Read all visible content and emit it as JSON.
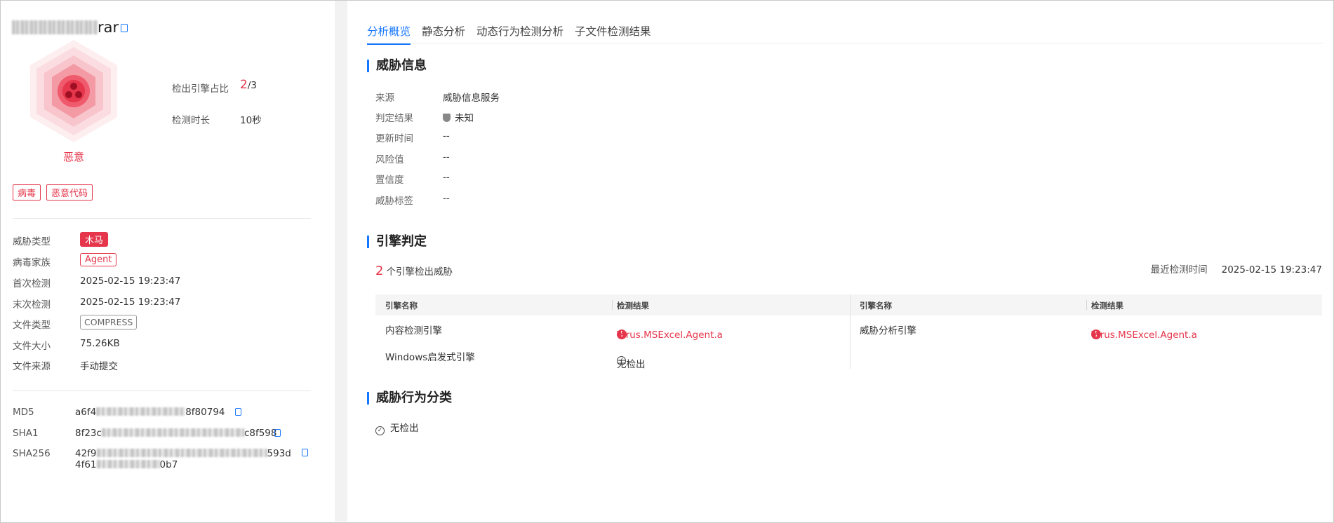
{
  "file": {
    "name_visible": "rar",
    "blurred": true
  },
  "verdict": {
    "label": "恶意"
  },
  "tags": [
    "病毒",
    "恶意代码"
  ],
  "stats": {
    "engine_ratio_label": "检出引擎占比",
    "engine_ratio_hit": "2",
    "engine_ratio_total": "/3",
    "duration_label": "检测时长",
    "duration_value": "10秒"
  },
  "info": {
    "threat_type_label": "威胁类型",
    "threat_type": "木马",
    "family_label": "病毒家族",
    "family": "Agent",
    "first_label": "首次检测",
    "first": "2025-02-15 19:23:47",
    "last_label": "末次检测",
    "last": "2025-02-15 19:23:47",
    "type_label": "文件类型",
    "type": "COMPRESS",
    "size_label": "文件大小",
    "size": "75.26KB",
    "source_label": "文件来源",
    "source": "手动提交"
  },
  "hashes": {
    "md5_label": "MD5",
    "md5_prefix": "a6f4",
    "md5_suffix": "8f80794",
    "sha1_label": "SHA1",
    "sha1_prefix": "8f23c",
    "sha1_suffix": "c8f598",
    "sha256_label": "SHA256",
    "sha256_l1_prefix": "42f9",
    "sha256_l1_suffix": "593d",
    "sha256_l2_prefix": "4f61",
    "sha256_l2_suffix": "0b7"
  },
  "tabs": [
    "分析概览",
    "静态分析",
    "动态行为检测分析",
    "子文件检测结果"
  ],
  "threat_info": {
    "title": "威胁信息",
    "rows": [
      {
        "label": "来源",
        "value": "威胁信息服务"
      },
      {
        "label": "判定结果",
        "value": "未知"
      },
      {
        "label": "更新时间",
        "value": "--"
      },
      {
        "label": "风险值",
        "value": "--"
      },
      {
        "label": "置信度",
        "value": "--"
      },
      {
        "label": "威胁标签",
        "value": "--"
      }
    ]
  },
  "engine": {
    "title": "引擎判定",
    "count": "2",
    "count_suffix": "个引擎检出威胁",
    "last_time_label": "最近检测时间",
    "last_time": "2025-02-15 19:23:47",
    "col_name": "引擎名称",
    "col_result": "检测结果",
    "rows": [
      {
        "name": "内容检测引擎",
        "result": "Virus.MSExcel.Agent.a",
        "malicious": true
      },
      {
        "name": "Windows启发式引擎",
        "result": "无检出",
        "malicious": false
      },
      {
        "name": "威胁分析引擎",
        "result": "Virus.MSExcel.Agent.a",
        "malicious": true
      }
    ]
  },
  "behavior": {
    "title": "威胁行为分类",
    "result": "无检出"
  },
  "colors": {
    "accent": "#1677ff",
    "danger": "#e5364b"
  }
}
